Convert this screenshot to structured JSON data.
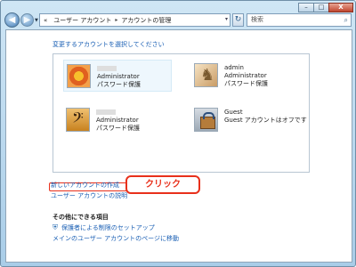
{
  "window": {
    "min_label": "–",
    "max_label": "□",
    "close_label": "X"
  },
  "nav": {
    "back_label": "◀",
    "forward_label": "▶",
    "dropdown_label": "▼"
  },
  "address": {
    "prefix": "«",
    "crumbs": [
      "ユーザー アカウント",
      "アカウントの管理"
    ],
    "separator": "▸",
    "dropdown_label": "▾",
    "refresh_label": "↻"
  },
  "search": {
    "placeholder": "検索",
    "icon_label": "⌕"
  },
  "main": {
    "heading": "変更するアカウントを選択してください",
    "accounts": [
      {
        "name": "",
        "role": "Administrator",
        "status": "パスワード保護",
        "avatar": "flower-icon",
        "selected": true
      },
      {
        "name": "admin",
        "role": "Administrator",
        "status": "パスワード保護",
        "avatar": "chess-icon",
        "selected": false
      },
      {
        "name": "",
        "role": "Administrator",
        "status": "パスワード保護",
        "avatar": "guitar-icon",
        "selected": false
      },
      {
        "name": "Guest",
        "role": "Guest アカウントはオフです",
        "status": "",
        "avatar": "guest-briefcase-icon",
        "selected": false
      }
    ],
    "links": {
      "create_account": "新しいアカウントの作成",
      "about_accounts": "ユーザー アカウントの説明"
    },
    "callout": "クリック",
    "other": {
      "heading": "その他にできる項目",
      "shield_icon": "⛨",
      "parental_controls": "保護者による制限のセットアップ",
      "main_page": "メインのユーザー アカウントのページに移動"
    }
  },
  "colors": {
    "link": "#1a5fb4",
    "callout": "#e8301b"
  }
}
